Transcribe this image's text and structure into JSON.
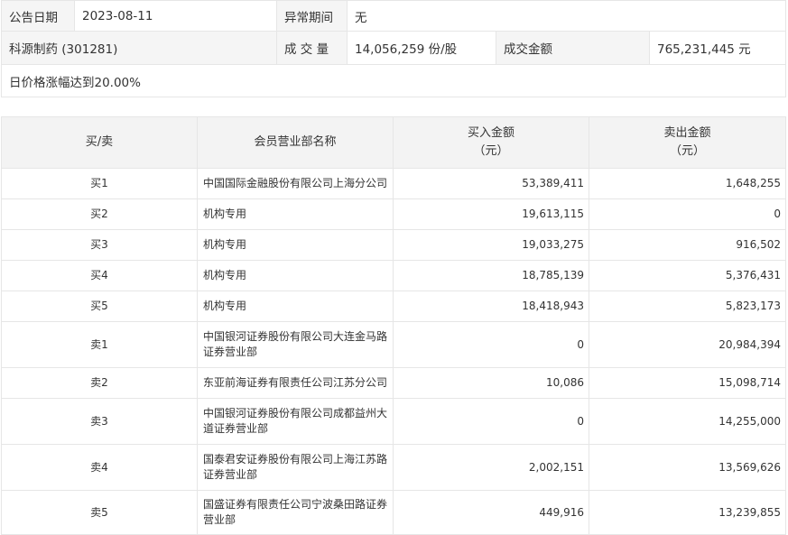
{
  "info": {
    "date_label": "公告日期",
    "date_value": "2023-08-11",
    "period_label": "异常期间",
    "period_value": "无",
    "stock_name": "科源制药 (301281)",
    "volume_label": "成 交 量",
    "volume_value": "14,056,259 份/股",
    "amount_label": "成交金额",
    "amount_value": "765,231,445 元",
    "reason": "日价格涨幅达到20.00%"
  },
  "table": {
    "headers": {
      "side": "买/卖",
      "name": "会员营业部名称",
      "buy_line1": "买入金额",
      "buy_line2": "（元）",
      "sell_line1": "卖出金额",
      "sell_line2": "（元）"
    },
    "rows": [
      {
        "side": "买1",
        "name": "中国国际金融股份有限公司上海分公司",
        "buy": "53,389,411",
        "sell": "1,648,255"
      },
      {
        "side": "买2",
        "name": "机构专用",
        "buy": "19,613,115",
        "sell": "0"
      },
      {
        "side": "买3",
        "name": "机构专用",
        "buy": "19,033,275",
        "sell": "916,502"
      },
      {
        "side": "买4",
        "name": "机构专用",
        "buy": "18,785,139",
        "sell": "5,376,431"
      },
      {
        "side": "买5",
        "name": "机构专用",
        "buy": "18,418,943",
        "sell": "5,823,173"
      },
      {
        "side": "卖1",
        "name": "中国银河证券股份有限公司大连金马路证券营业部",
        "buy": "0",
        "sell": "20,984,394"
      },
      {
        "side": "卖2",
        "name": "东亚前海证券有限责任公司江苏分公司",
        "buy": "10,086",
        "sell": "15,098,714"
      },
      {
        "side": "卖3",
        "name": "中国银河证券股份有限公司成都益州大道证券营业部",
        "buy": "0",
        "sell": "14,255,000"
      },
      {
        "side": "卖4",
        "name": "国泰君安证券股份有限公司上海江苏路证券营业部",
        "buy": "2,002,151",
        "sell": "13,569,626"
      },
      {
        "side": "卖5",
        "name": "国盛证券有限责任公司宁波桑田路证券营业部",
        "buy": "449,916",
        "sell": "13,239,855"
      }
    ]
  }
}
